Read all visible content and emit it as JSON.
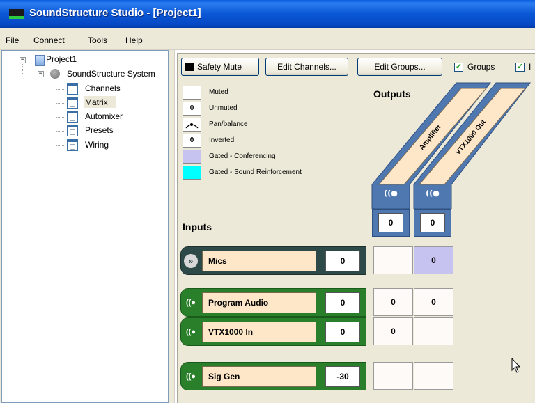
{
  "window": {
    "title": "SoundStructure Studio - [Project1]"
  },
  "menu": [
    "File",
    "Connect",
    "Tools",
    "Help"
  ],
  "tree": {
    "project": "Project1",
    "system": "SoundStructure System",
    "items": [
      "Channels",
      "Matrix",
      "Automixer",
      "Presets",
      "Wiring"
    ],
    "selected": "Matrix"
  },
  "toolbar": {
    "safety_mute": "Safety Mute",
    "edit_channels": "Edit Channels...",
    "edit_groups": "Edit Groups...",
    "groups_label": "Groups",
    "groups_checked": true,
    "second_checkbox_label": "I",
    "second_checked": true
  },
  "legend": [
    {
      "swatch": "",
      "label": "Muted",
      "color": "#ffffff"
    },
    {
      "swatch": "0",
      "label": "Unmuted",
      "color": "#ffffff"
    },
    {
      "swatch": "",
      "label": "Pan/balance",
      "color": "#ffffff"
    },
    {
      "swatch": "0",
      "label": "Inverted",
      "color": "#ffffff"
    },
    {
      "swatch": "",
      "label": "Gated - Conferencing",
      "color": "#c6c3f0"
    },
    {
      "swatch": "",
      "label": "Gated - Sound Reinforcement",
      "color": "#00ffff"
    }
  ],
  "outputs_title": "Outputs",
  "inputs_title": "Inputs",
  "outputs": [
    {
      "name": "Amplifier",
      "value": "0"
    },
    {
      "name": "VTX1000 Out",
      "value": "0"
    }
  ],
  "inputs": [
    {
      "name": "Mics",
      "gain": "0",
      "type": "group",
      "cells": [
        "",
        "0"
      ],
      "cell_colors": [
        "#fdfaf7",
        "#c6c3f0"
      ]
    },
    {
      "name": "Program Audio",
      "gain": "0",
      "type": "channel",
      "cells": [
        "0",
        "0"
      ],
      "cell_colors": [
        "#fdfaf7",
        "#fdfaf7"
      ]
    },
    {
      "name": "VTX1000 In",
      "gain": "0",
      "type": "channel",
      "cells": [
        "0",
        ""
      ],
      "cell_colors": [
        "#fdfaf7",
        "#fdfaf7"
      ]
    },
    {
      "name": "Sig Gen",
      "gain": "-30",
      "type": "channel",
      "cells": [
        "",
        ""
      ],
      "cell_colors": [
        "#fdfaf7",
        "#fdfaf7"
      ]
    }
  ],
  "colors": {
    "titlebar": "#0a57d6",
    "output_strip": "#4f78b0",
    "channel_green": "#2a7f2a",
    "group_dark": "#2e4a48",
    "name_fill": "#fde7c8"
  },
  "icons": {
    "group_icon": "chevron-double-down-icon",
    "channel_icon": "signal-wave-icon"
  }
}
